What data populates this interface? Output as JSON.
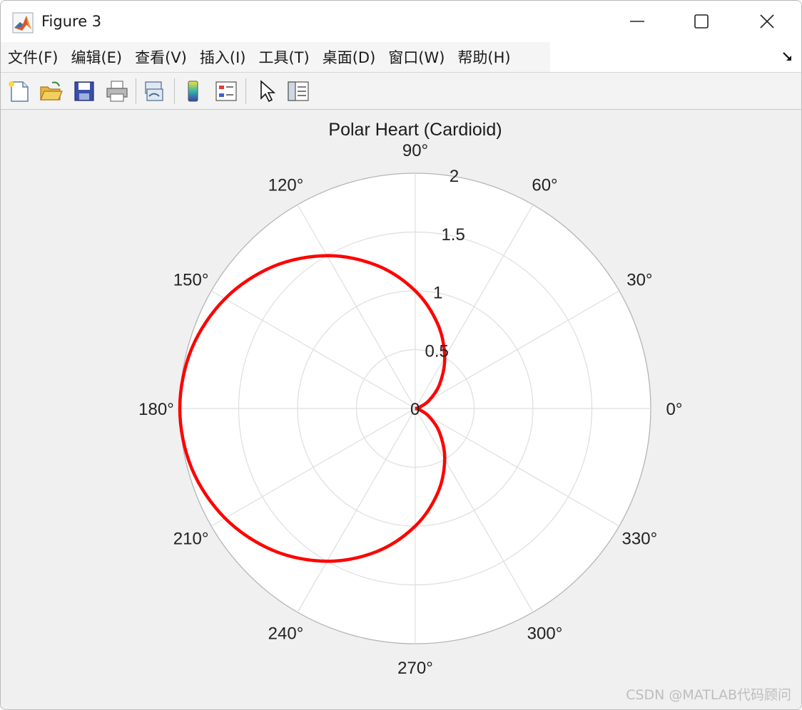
{
  "window": {
    "title": "Figure 3",
    "controls": [
      "minimize",
      "maximize",
      "close"
    ]
  },
  "menubar": {
    "items": [
      "文件(F)",
      "编辑(E)",
      "查看(V)",
      "插入(I)",
      "工具(T)",
      "桌面(D)",
      "窗口(W)",
      "帮助(H)"
    ]
  },
  "toolbar": {
    "buttons": [
      {
        "icon": "new-figure-icon"
      },
      {
        "icon": "open-file-icon"
      },
      {
        "icon": "save-icon"
      },
      {
        "icon": "print-icon"
      },
      {
        "icon": "link-plot-icon"
      },
      {
        "icon": "colorbar-icon"
      },
      {
        "icon": "legend-icon"
      },
      {
        "icon": "edit-plot-pointer-icon"
      },
      {
        "icon": "property-inspector-icon"
      }
    ]
  },
  "chart_data": {
    "type": "line",
    "projection": "polar",
    "title": "Polar Heart (Cardioid)",
    "equation_shape": "r = 1 - cos(theta)",
    "theta_ticks_deg": [
      0,
      30,
      60,
      90,
      120,
      150,
      180,
      210,
      240,
      270,
      300,
      330
    ],
    "theta_tick_labels": [
      "0°",
      "30°",
      "60°",
      "90°",
      "120°",
      "150°",
      "180°",
      "210°",
      "240°",
      "270°",
      "300°",
      "330°"
    ],
    "r_ticks": [
      0,
      0.5,
      1,
      1.5,
      2
    ],
    "r_tick_labels": [
      "0",
      "0.5",
      "1",
      "1.5",
      "2"
    ],
    "rlim": [
      0,
      2
    ],
    "grid": true,
    "series": [
      {
        "color": "#ff0000",
        "theta_deg": [
          0,
          15,
          30,
          45,
          60,
          75,
          90,
          105,
          120,
          135,
          150,
          165,
          180,
          195,
          210,
          225,
          240,
          255,
          270,
          285,
          300,
          315,
          330,
          345,
          360
        ],
        "r": [
          0,
          0.034,
          0.134,
          0.293,
          0.5,
          0.741,
          1.0,
          1.259,
          1.5,
          1.707,
          1.866,
          1.966,
          2.0,
          1.966,
          1.866,
          1.707,
          1.5,
          1.259,
          1.0,
          0.741,
          0.5,
          0.293,
          0.134,
          0.034,
          0
        ]
      }
    ]
  },
  "watermark": "CSDN @MATLAB代码顾问"
}
